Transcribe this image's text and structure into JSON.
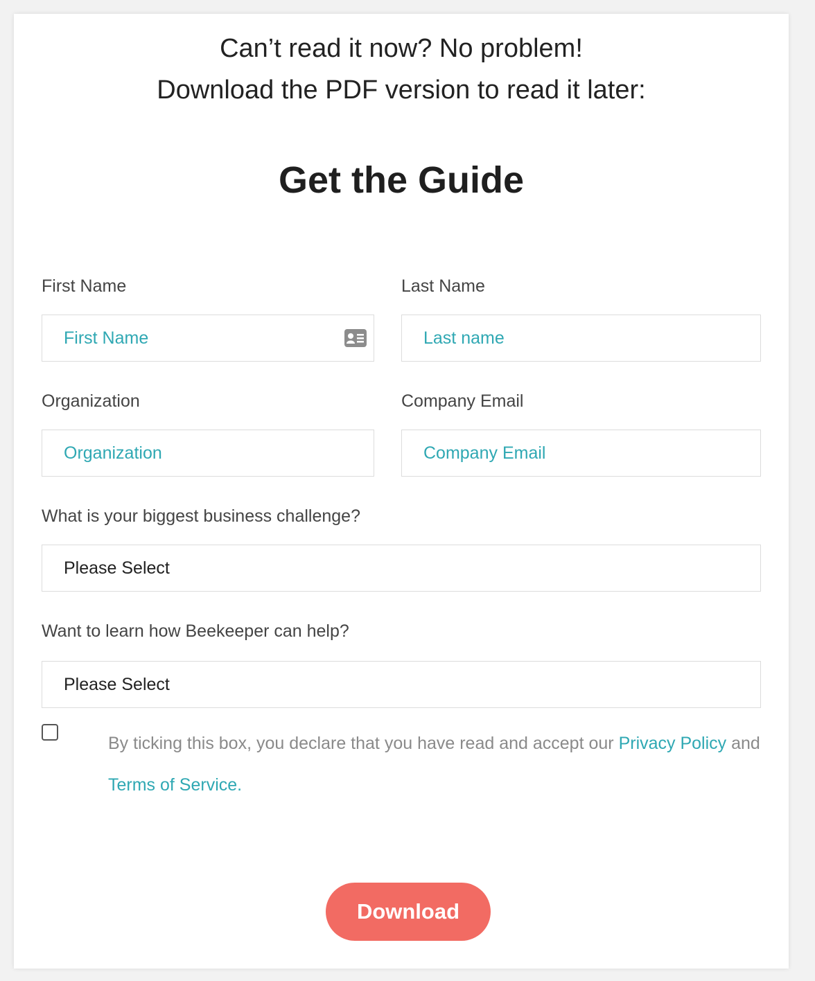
{
  "intro": {
    "line1": "Can’t read it now? No problem!",
    "line2": "Download the PDF version to read it later:"
  },
  "title": "Get the Guide",
  "form": {
    "first_name": {
      "label": "First Name",
      "placeholder": "First Name",
      "icon": "contact-card-icon"
    },
    "last_name": {
      "label": "Last Name",
      "placeholder": "Last name"
    },
    "organization": {
      "label": "Organization",
      "placeholder": "Organization"
    },
    "company_email": {
      "label": "Company Email",
      "placeholder": "Company Email"
    },
    "challenge": {
      "label": "What is your biggest business challenge?",
      "value": "Please Select"
    },
    "learn": {
      "label": "Want to learn how Beekeeper can help?",
      "value": "Please Select"
    },
    "consent": {
      "text_before": "By ticking this box, you declare that you have read and accept our ",
      "privacy_link": "Privacy Policy",
      "text_and": " and",
      "terms_link": "Terms of Service."
    },
    "download_label": "Download"
  },
  "colors": {
    "accent": "#2fa8b3",
    "button": "#f26b63",
    "text": "#222222"
  }
}
